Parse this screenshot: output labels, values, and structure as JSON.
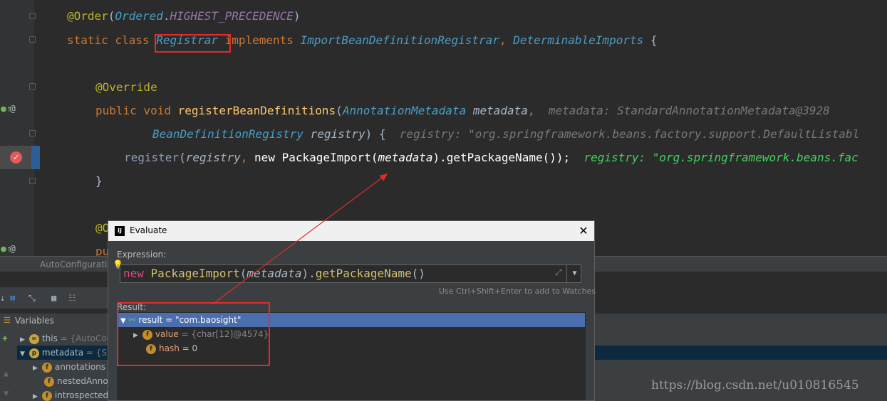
{
  "code": {
    "line1": {
      "anno": "@Order",
      "paren_open": "(",
      "cls": "Ordered",
      "dot": ".",
      "const": "HIGHEST_PRECEDENCE",
      "paren_close": ")"
    },
    "line2": {
      "kw1": "static",
      "kw2": "class",
      "name": "Registrar",
      "kw3": "implements",
      "iface1": "ImportBeanDefinitionRegistrar",
      "comma": ",",
      "iface2": "DeterminableImports",
      "brace": "{"
    },
    "line3": {
      "anno": "@Override"
    },
    "line4": {
      "kw1": "public",
      "kw2": "void",
      "fn": "registerBeanDefinitions",
      "paren": "(",
      "type": "AnnotationMetadata",
      "param": "metadata",
      "comma": ",",
      "hint": "metadata: StandardAnnotationMetadata@3928"
    },
    "line5": {
      "type": "BeanDefinitionRegistry",
      "param": "registry",
      "close": ") {",
      "hint": "registry: \"org.springframework.beans.factory.support.DefaultListabl"
    },
    "line6": {
      "fn": "register",
      "paren": "(",
      "param": "registry",
      "comma": ",",
      "kw": "new",
      "rest": "PackageImport(",
      "arg": "metadata",
      "tail": ").getPackageName());",
      "hint": "registry: \"org.springframework.beans.fac"
    },
    "line7": {
      "brace": "}"
    },
    "line8": {
      "anno": "@O"
    },
    "line9": {
      "kw": "pu"
    }
  },
  "breadcrumb": {
    "text": "AutoConfiguratio"
  },
  "variables": {
    "header": "Variables",
    "rows": [
      {
        "name": "this",
        "value": " = {AutoCont"
      },
      {
        "name": "metadata",
        "value": " = {Stan"
      },
      {
        "name": "annotations",
        "value": " ="
      },
      {
        "name": "nestedAnnota",
        "value": ""
      },
      {
        "name": "introspectedC",
        "value": ""
      }
    ]
  },
  "dialog": {
    "title": "Evaluate",
    "logo": "IJ",
    "close": "✕",
    "expression_label": "Expression:",
    "expression": {
      "kw": "new",
      "cls": "PackageImport",
      "open": "(",
      "arg": "metadata",
      "close": ")",
      "dot": ".",
      "fn": "getPackageName",
      "call": "()"
    },
    "hint": "Use Ctrl+Shift+Enter to add to Watches",
    "result_label": "Result:",
    "result": {
      "root": "result = \"com.baosight\"",
      "children": [
        {
          "name": "value",
          "value": " = {char[12]@4574}"
        },
        {
          "name": "hash",
          "value": " = 0"
        }
      ]
    }
  },
  "watermark": "https://blog.csdn.net/u010816545",
  "colors": {
    "background": "#2b2b2b",
    "exec_line": "#2e5e96",
    "annotation_box": "#e32b2b",
    "keyword": "#cc7832"
  }
}
